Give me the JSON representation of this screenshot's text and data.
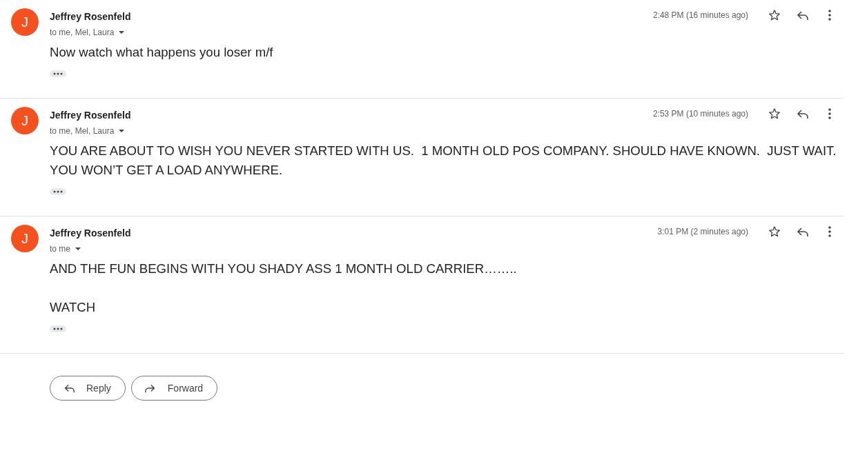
{
  "messages": [
    {
      "sender": "Jeffrey Rosenfeld",
      "avatar_letter": "J",
      "recipients": "to me, Mel, Laura",
      "time": "2:48 PM (16 minutes ago)",
      "starred": false,
      "body": [
        "Now watch what happens you loser m/f"
      ]
    },
    {
      "sender": "Jeffrey Rosenfeld",
      "avatar_letter": "J",
      "recipients": "to me, Mel, Laura",
      "time": "2:53 PM (10 minutes ago)",
      "starred": false,
      "body": [
        "YOU ARE ABOUT TO WISH YOU NEVER STARTED WITH US.  1 MONTH OLD POS COMPANY. SHOULD HAVE KNOWN.  JUST WAIT. YOU WON’T GET A LOAD ANYWHERE."
      ]
    },
    {
      "sender": "Jeffrey Rosenfeld",
      "avatar_letter": "J",
      "recipients": "to me",
      "time": "3:01 PM (2 minutes ago)",
      "starred": false,
      "body": [
        "AND THE FUN BEGINS WITH YOU SHADY ASS 1 MONTH OLD CARRIER……..",
        "WATCH"
      ]
    }
  ],
  "actions": [
    {
      "kind": "reply",
      "label": "Reply"
    },
    {
      "kind": "forward",
      "label": "Forward"
    }
  ]
}
